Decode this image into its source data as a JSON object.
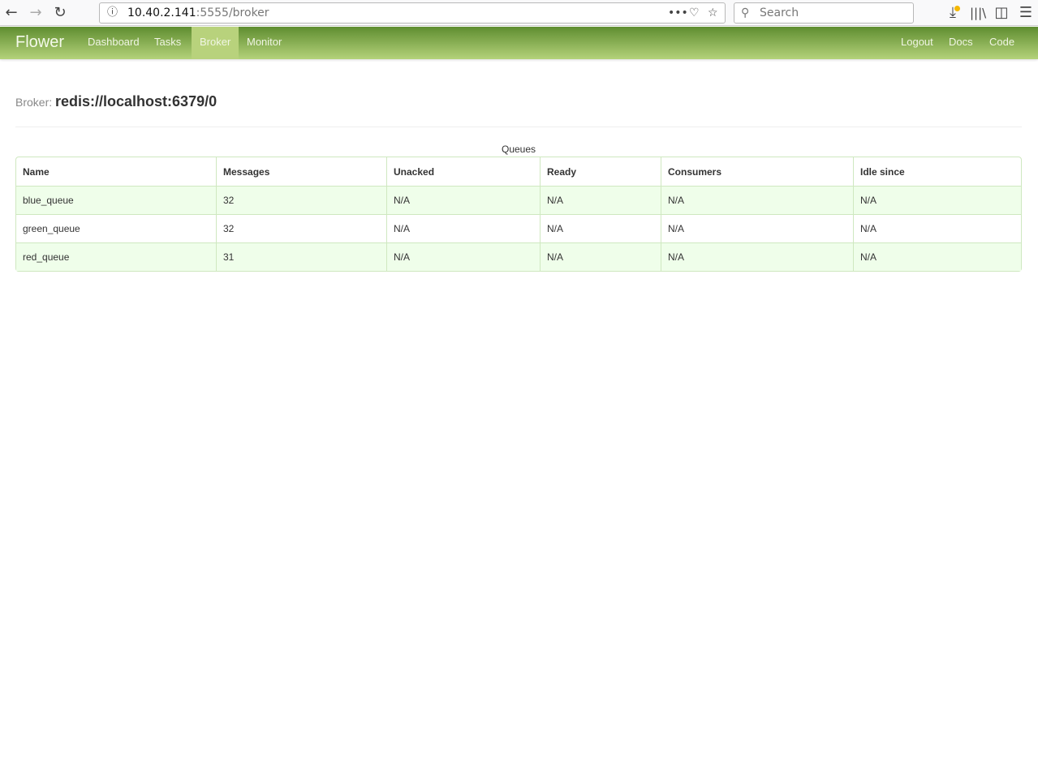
{
  "browser": {
    "url_host": "10.40.2.141",
    "url_path": ":5555/broker",
    "search_placeholder": "Search"
  },
  "nav": {
    "brand": "Flower",
    "items": [
      "Dashboard",
      "Tasks",
      "Broker",
      "Monitor"
    ],
    "right": [
      "Logout",
      "Docs",
      "Code"
    ]
  },
  "broker": {
    "label": "Broker:",
    "url": "redis://localhost:6379/0"
  },
  "table": {
    "caption": "Queues",
    "headers": [
      "Name",
      "Messages",
      "Unacked",
      "Ready",
      "Consumers",
      "Idle since"
    ],
    "rows": [
      [
        "blue_queue",
        "32",
        "N/A",
        "N/A",
        "N/A",
        "N/A"
      ],
      [
        "green_queue",
        "32",
        "N/A",
        "N/A",
        "N/A",
        "N/A"
      ],
      [
        "red_queue",
        "31",
        "N/A",
        "N/A",
        "N/A",
        "N/A"
      ]
    ]
  }
}
